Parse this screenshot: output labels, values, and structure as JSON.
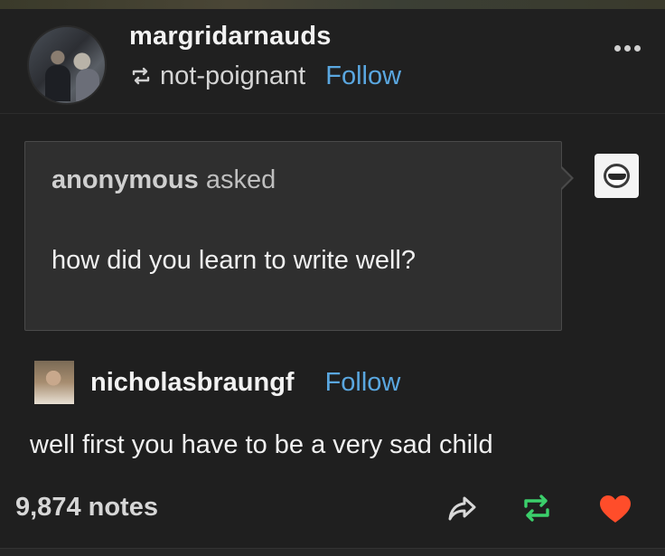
{
  "post": {
    "username": "margridarnauds",
    "reblogged_from": "not-poignant",
    "follow_label": "Follow",
    "more_icon": "ellipsis-icon",
    "reblog_icon": "reblog-icon"
  },
  "ask": {
    "asker": "anonymous",
    "asked_label": "asked",
    "question": "how did you learn to write well?",
    "asker_avatar_icon": "sunglasses-face-icon"
  },
  "answer": {
    "username": "nicholasbraungf",
    "follow_label": "Follow",
    "text": "well first you have to be a very sad child"
  },
  "footer": {
    "notes": "9,874 notes",
    "share_icon": "share-icon",
    "reblog_icon": "reblog-icon",
    "like_icon": "heart-icon"
  },
  "colors": {
    "background": "#1f1f1f",
    "follow_blue": "#5aa7e0",
    "reblog_green": "#3bcf6b",
    "like_red": "#ff4d2a",
    "ask_bg": "#2f2f2f"
  }
}
